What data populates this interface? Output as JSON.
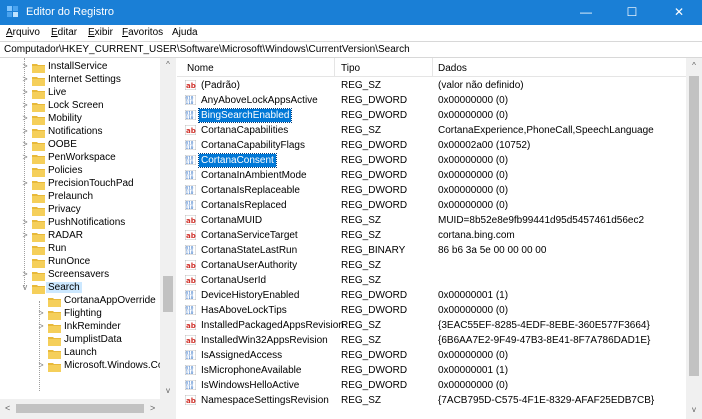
{
  "window": {
    "title": "Editor do Registro",
    "minimize": "—",
    "maximize": "☐",
    "close": "✕"
  },
  "menu": [
    {
      "label": "Arquivo",
      "accel": "A",
      "rest": "rquivo"
    },
    {
      "label": "Editar",
      "accel": "E",
      "rest": "ditar"
    },
    {
      "label": "Exibir",
      "accel": "E",
      "rest": "xibir"
    },
    {
      "label": "Favoritos",
      "accel": "F",
      "rest": "avoritos"
    },
    {
      "label": "Ajuda",
      "accel": "",
      "rest": "Ajuda"
    }
  ],
  "address": "Computador\\HKEY_CURRENT_USER\\Software\\Microsoft\\Windows\\CurrentVersion\\Search",
  "tree": [
    {
      "label": "InstallService",
      "expander": ">"
    },
    {
      "label": "Internet Settings",
      "expander": ">"
    },
    {
      "label": "Live",
      "expander": ">"
    },
    {
      "label": "Lock Screen",
      "expander": ">"
    },
    {
      "label": "Mobility",
      "expander": ">"
    },
    {
      "label": "Notifications",
      "expander": ">"
    },
    {
      "label": "OOBE",
      "expander": ">"
    },
    {
      "label": "PenWorkspace",
      "expander": ">"
    },
    {
      "label": "Policies",
      "expander": ""
    },
    {
      "label": "PrecisionTouchPad",
      "expander": ">"
    },
    {
      "label": "Prelaunch",
      "expander": ""
    },
    {
      "label": "Privacy",
      "expander": ""
    },
    {
      "label": "PushNotifications",
      "expander": ">"
    },
    {
      "label": "RADAR",
      "expander": ">"
    },
    {
      "label": "Run",
      "expander": ""
    },
    {
      "label": "RunOnce",
      "expander": ""
    },
    {
      "label": "Screensavers",
      "expander": ">"
    },
    {
      "label": "Search",
      "expander": "v",
      "selected": true
    },
    {
      "label": "CortanaAppOverride",
      "expander": "",
      "child": true
    },
    {
      "label": "Flighting",
      "expander": ">",
      "child": true
    },
    {
      "label": "InkReminder",
      "expander": ">",
      "child": true
    },
    {
      "label": "JumplistData",
      "expander": "",
      "child": true
    },
    {
      "label": "Launch",
      "expander": "",
      "child": true
    },
    {
      "label": "Microsoft.Windows.Cor",
      "expander": ">",
      "child": true
    }
  ],
  "columns": {
    "name": "Nome",
    "type": "Tipo",
    "data": "Dados"
  },
  "rows": [
    {
      "name": "(Padrão)",
      "type": "REG_SZ",
      "data": "(valor não definido)",
      "kind": "sz"
    },
    {
      "name": "AnyAboveLockAppsActive",
      "type": "REG_DWORD",
      "data": "0x00000000 (0)",
      "kind": "dword"
    },
    {
      "name": "BingSearchEnabled",
      "type": "REG_DWORD",
      "data": "0x00000000 (0)",
      "kind": "dword",
      "selected": true
    },
    {
      "name": "CortanaCapabilities",
      "type": "REG_SZ",
      "data": "CortanaExperience,PhoneCall,SpeechLanguage",
      "kind": "sz"
    },
    {
      "name": "CortanaCapabilityFlags",
      "type": "REG_DWORD",
      "data": "0x00002a00 (10752)",
      "kind": "dword"
    },
    {
      "name": "CortanaConsent",
      "type": "REG_DWORD",
      "data": "0x00000000 (0)",
      "kind": "dword",
      "selected": true
    },
    {
      "name": "CortanaInAmbientMode",
      "type": "REG_DWORD",
      "data": "0x00000000 (0)",
      "kind": "dword"
    },
    {
      "name": "CortanaIsReplaceable",
      "type": "REG_DWORD",
      "data": "0x00000000 (0)",
      "kind": "dword"
    },
    {
      "name": "CortanaIsReplaced",
      "type": "REG_DWORD",
      "data": "0x00000000 (0)",
      "kind": "dword"
    },
    {
      "name": "CortanaMUID",
      "type": "REG_SZ",
      "data": "MUID=8b52e8e9fb99441d95d5457461d56ec2",
      "kind": "sz"
    },
    {
      "name": "CortanaServiceTarget",
      "type": "REG_SZ",
      "data": "cortana.bing.com",
      "kind": "sz"
    },
    {
      "name": "CortanaStateLastRun",
      "type": "REG_BINARY",
      "data": "86 b6 3a 5e 00 00 00 00",
      "kind": "dword"
    },
    {
      "name": "CortanaUserAuthority",
      "type": "REG_SZ",
      "data": "",
      "kind": "sz"
    },
    {
      "name": "CortanaUserId",
      "type": "REG_SZ",
      "data": "",
      "kind": "sz"
    },
    {
      "name": "DeviceHistoryEnabled",
      "type": "REG_DWORD",
      "data": "0x00000001 (1)",
      "kind": "dword"
    },
    {
      "name": "HasAboveLockTips",
      "type": "REG_DWORD",
      "data": "0x00000000 (0)",
      "kind": "dword"
    },
    {
      "name": "InstalledPackagedAppsRevision",
      "type": "REG_SZ",
      "data": "{3EAC55EF-8285-4EDF-8EBE-360E577F3664}",
      "kind": "sz"
    },
    {
      "name": "InstalledWin32AppsRevision",
      "type": "REG_SZ",
      "data": "{6B6AA7E2-9F49-47B3-8E41-8F7A786DAD1E}",
      "kind": "sz"
    },
    {
      "name": "IsAssignedAccess",
      "type": "REG_DWORD",
      "data": "0x00000000 (0)",
      "kind": "dword"
    },
    {
      "name": "IsMicrophoneAvailable",
      "type": "REG_DWORD",
      "data": "0x00000001 (1)",
      "kind": "dword"
    },
    {
      "name": "IsWindowsHelloActive",
      "type": "REG_DWORD",
      "data": "0x00000000 (0)",
      "kind": "dword"
    },
    {
      "name": "NamespaceSettingsRevision",
      "type": "REG_SZ",
      "data": "{7ACB795D-C575-4F1E-8329-AFAF25EDB7CB}",
      "kind": "sz"
    }
  ],
  "scroll": {
    "up": "^",
    "down": "v",
    "left": "<",
    "right": ">"
  },
  "colors": {
    "titlebar": "#1a7fd6",
    "selection": "#0078d7",
    "tree_selection": "#cce8ff",
    "sz_icon": "#d1342d",
    "dword_icon": "#2f6fc4"
  }
}
